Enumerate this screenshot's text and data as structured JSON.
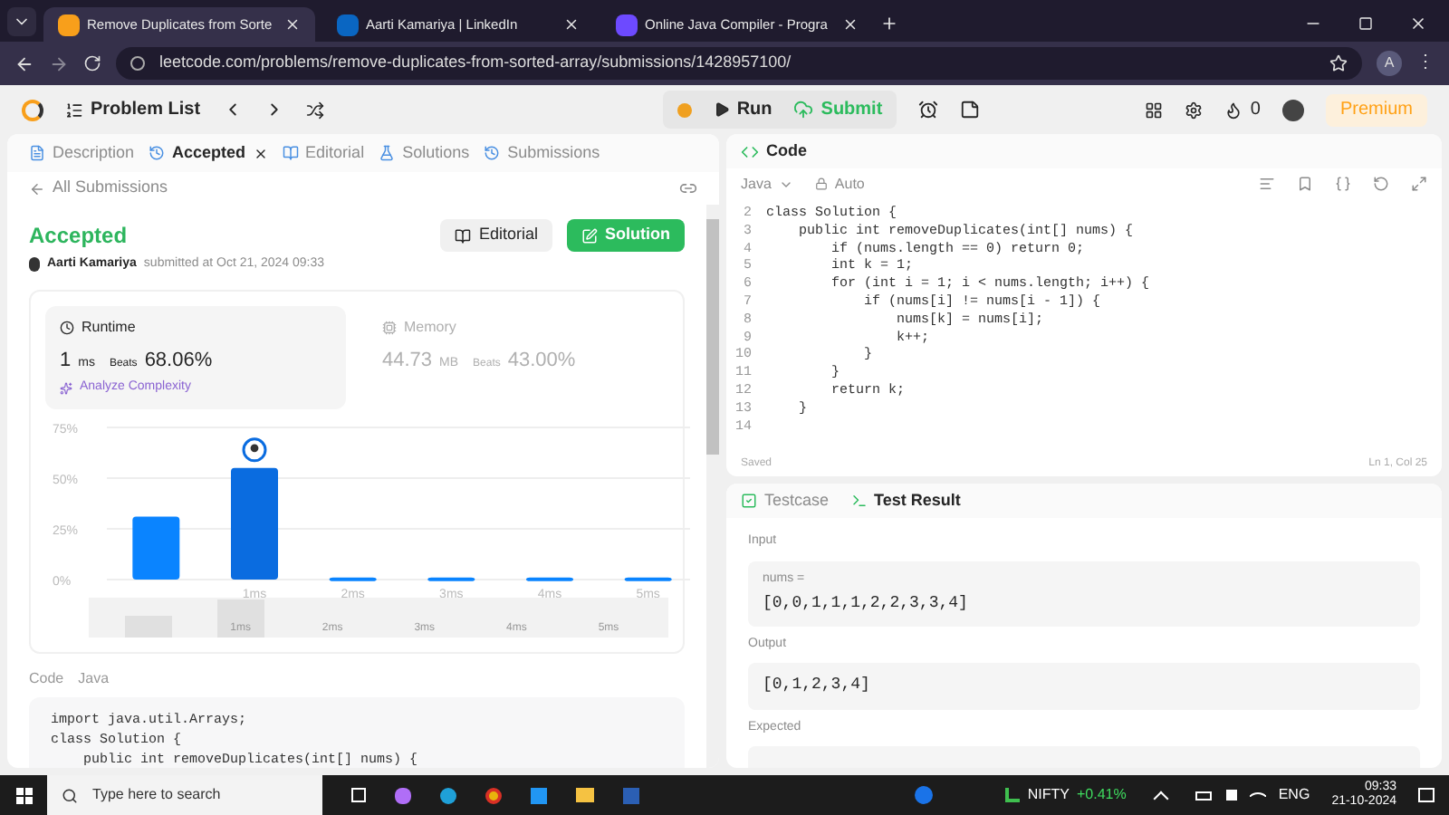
{
  "browser": {
    "tabs": [
      {
        "title": "Remove Duplicates from Sorte",
        "selected": true,
        "kind": "leetcode"
      },
      {
        "title": "Aarti Kamariya | LinkedIn",
        "selected": false,
        "kind": "linkedin"
      },
      {
        "title": "Online Java Compiler - Progra",
        "selected": false,
        "kind": "compiler"
      }
    ],
    "url": "leetcode.com/problems/remove-duplicates-from-sorted-array/submissions/1428957100/",
    "profile": "A",
    "menu": "⋮"
  },
  "toolbar": {
    "problem_list": "Problem List",
    "run": "Run",
    "submit": "Submit",
    "streak": "0",
    "premium": "Premium"
  },
  "left": {
    "tabs": [
      {
        "label": "Description",
        "selected": false,
        "closable": false
      },
      {
        "label": "Accepted",
        "selected": true,
        "closable": true
      },
      {
        "label": "Editorial",
        "selected": false,
        "closable": false
      },
      {
        "label": "Solutions",
        "selected": false,
        "closable": false
      },
      {
        "label": "Submissions",
        "selected": false,
        "closable": false
      }
    ],
    "back": "All Submissions",
    "status": "Accepted",
    "user": "Aarti Kamariya",
    "submitted": "submitted at Oct 21, 2024 09:33",
    "editorial_button": "Editorial",
    "solution_button": "Solution",
    "stats": [
      {
        "kind": "runtime",
        "label": "Runtime",
        "value": "1",
        "unit": "ms",
        "beats_label": "Beats",
        "beats": "68.06%",
        "selected": true,
        "analyze": "Analyze Complexity"
      },
      {
        "kind": "memory",
        "label": "Memory",
        "value": "44.73",
        "unit": "MB",
        "beats_label": "Beats",
        "beats": "43.00%",
        "selected": false
      }
    ],
    "chart_data": {
      "type": "bar",
      "categories": [
        null,
        "1ms",
        "2ms",
        "3ms",
        "4ms",
        "5ms"
      ],
      "values": [
        31,
        55,
        1,
        1,
        1,
        1
      ],
      "ylim": [
        0,
        75
      ],
      "yticks": [
        {
          "value": 0,
          "label": "0%"
        },
        {
          "value": 25,
          "label": "25%"
        },
        {
          "value": 50,
          "label": "50%"
        },
        {
          "value": 75,
          "label": "75%"
        }
      ]
    },
    "brush_labels": [
      "1ms",
      "2ms",
      "3ms",
      "4ms",
      "5ms"
    ],
    "code_label": "Code",
    "code_lang": "Java",
    "code": [
      "import java.util.Arrays;",
      "class Solution {",
      "    public int removeDuplicates(int[] nums) {"
    ]
  },
  "editor": {
    "title": "Code",
    "language": "Java",
    "mode": "Auto",
    "lines": [
      {
        "n": "2",
        "text": "class Solution {"
      },
      {
        "n": "3",
        "text": "    public int removeDuplicates(int[] nums) {"
      },
      {
        "n": "4",
        "text": "        if (nums.length == 0) return 0;"
      },
      {
        "n": "5",
        "text": "        int k = 1;"
      },
      {
        "n": "6",
        "text": "        for (int i = 1; i < nums.length; i++) {"
      },
      {
        "n": "7",
        "text": "            if (nums[i] != nums[i - 1]) {"
      },
      {
        "n": "8",
        "text": "                nums[k] = nums[i];"
      },
      {
        "n": "9",
        "text": "                k++;"
      },
      {
        "n": "10",
        "text": "            }"
      },
      {
        "n": "11",
        "text": "        }"
      },
      {
        "n": "12",
        "text": "        return k;"
      },
      {
        "n": "13",
        "text": "    }"
      },
      {
        "n": "14"
      }
    ],
    "saved": "Saved",
    "cursor": "Ln 1, Col 25"
  },
  "results": {
    "tabs": [
      {
        "label": "Testcase",
        "selected": false
      },
      {
        "label": "Test Result",
        "selected": true
      }
    ],
    "input_label": "Input",
    "var": "nums =",
    "input": "[0,0,1,1,1,2,2,3,3,4]",
    "output_label": "Output",
    "output": "[0,1,2,3,4]",
    "expected_label": "Expected"
  },
  "taskbar": {
    "search": "Type here to search",
    "ticker": "NIFTY",
    "change": "+0.41%",
    "lang": "ENG",
    "time": "09:33",
    "date": "21-10-2024"
  }
}
